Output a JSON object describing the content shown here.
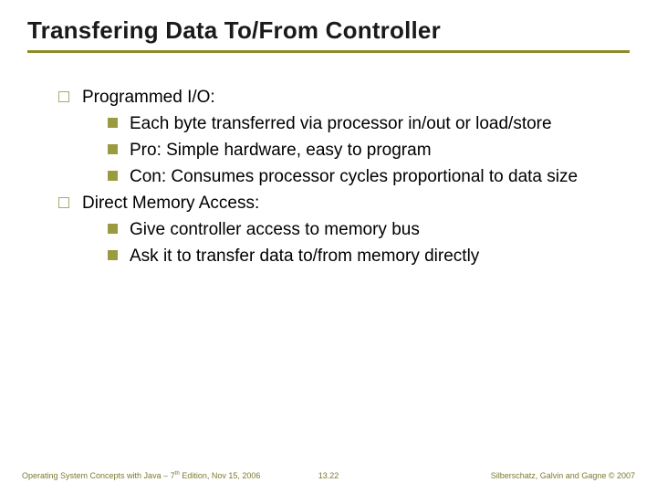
{
  "title": "Transfering Data To/From Controller",
  "items": [
    {
      "text": "Programmed I/O:",
      "sub": [
        "Each byte transferred via processor in/out or load/store",
        "Pro: Simple hardware, easy to program",
        "Con: Consumes processor cycles proportional to data size"
      ]
    },
    {
      "text": "Direct Memory Access:",
      "sub": [
        "Give controller access to memory bus",
        "Ask it to transfer data to/from memory directly"
      ]
    }
  ],
  "footer": {
    "left_prefix": "Operating System Concepts with Java – 7",
    "left_sup": "th",
    "left_suffix": " Edition, Nov 15, 2006",
    "center": "13.22",
    "right": "Silberschatz, Galvin and Gagne © 2007"
  }
}
